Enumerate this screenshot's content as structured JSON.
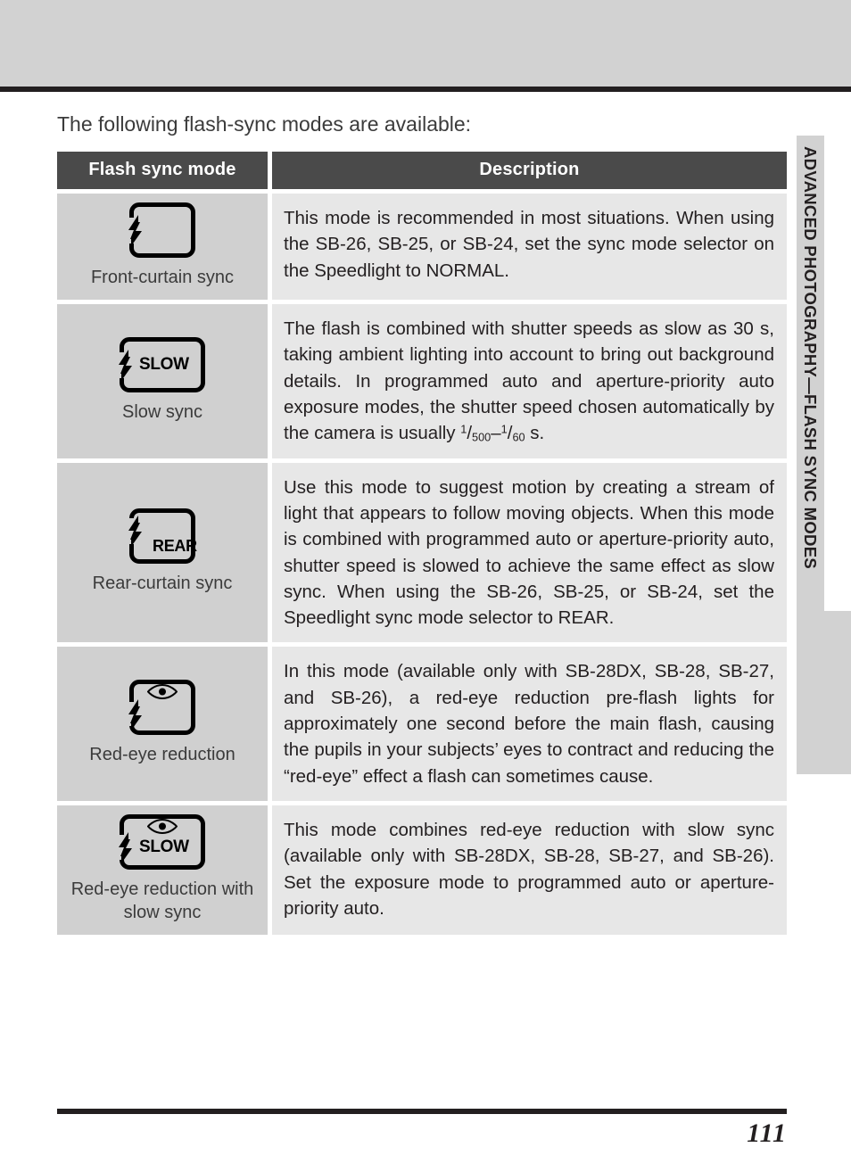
{
  "page": {
    "number": "111",
    "side_tab": "ADVANCED PHOTOGRAPHY—FLASH SYNC MODES",
    "intro": "The following flash-sync modes are available:"
  },
  "table": {
    "headers": {
      "mode": "Flash sync mode",
      "description": "Description"
    },
    "rows": [
      {
        "icon": "front-curtain-sync-icon",
        "label": "Front-curtain sync",
        "description": "This mode is recommended in most situations. When using the SB-26, SB-25, or SB-24, set the sync mode selector on the Speedlight to NORMAL."
      },
      {
        "icon": "slow-sync-icon",
        "icon_text": "SLOW",
        "label": "Slow sync",
        "description_part1": "The flash is combined with shutter speeds as slow as 30 s, taking ambient lighting into account to bring out background details.  In programmed auto and aperture-priority auto exposure modes, the shutter speed chosen automatically by the camera is usually ",
        "fraction1_num": "1",
        "fraction1_den": "500",
        "fraction_sep": "–",
        "fraction2_num": "1",
        "fraction2_den": "60",
        "description_part2": " s."
      },
      {
        "icon": "rear-curtain-sync-icon",
        "icon_text": "REAR",
        "label": "Rear-curtain sync",
        "description": "Use this mode to suggest motion by creating a stream of light that appears to follow moving objects. When this mode is combined with programmed auto or aperture-priority auto, shutter speed is slowed to achieve the same effect as slow sync. When using the SB-26, SB-25, or SB-24, set the Speedlight sync mode selector to REAR."
      },
      {
        "icon": "red-eye-reduction-icon",
        "label": "Red-eye reduction",
        "description": "In this mode (available only with SB-28DX, SB-28, SB-27, and SB-26), a red-eye reduction pre-flash lights for approximately one second before the main flash, causing the pupils in your subjects’ eyes to contract and reducing the “red-eye” effect a flash can sometimes cause."
      },
      {
        "icon": "red-eye-reduction-slow-sync-icon",
        "icon_text": "SLOW",
        "label": "Red-eye reduction with slow sync",
        "description": "This mode combines red-eye reduction with slow sync (available only with SB-28DX, SB-28, SB-27, and SB-26).  Set the exposure mode to programmed auto or aperture-priority auto."
      }
    ]
  },
  "colors": {
    "header_bar": "#4a4a4a",
    "mode_cell": "#d0d0d0",
    "desc_cell": "#e7e7e7",
    "rule": "#231f20",
    "tab": "#d2d2d2"
  }
}
